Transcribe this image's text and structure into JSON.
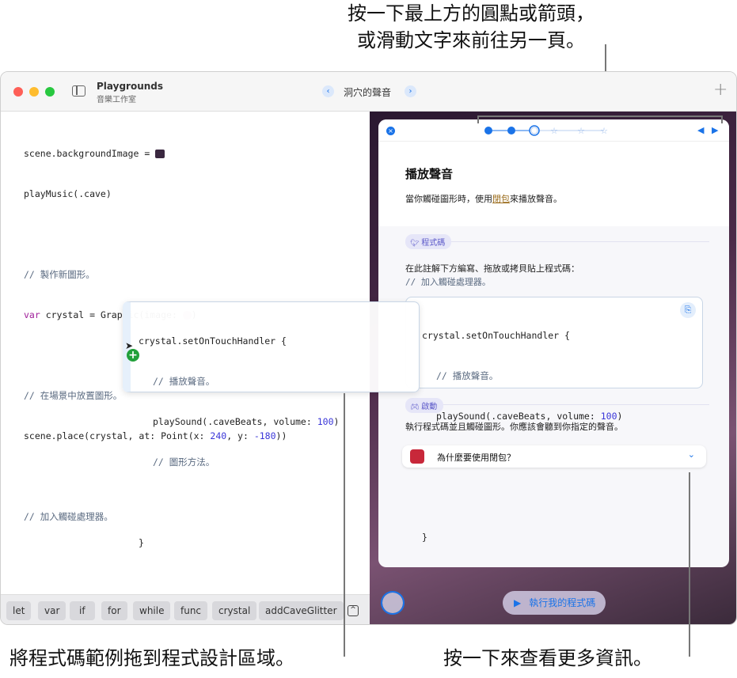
{
  "callouts": {
    "top_line1": "按一下最上方的圓點或箭頭，",
    "top_line2": "或滑動文字來前往另一頁。",
    "bottom_left": "將程式碼範例拖到程式設計區域。",
    "bottom_right": "按一下來查看更多資訊。"
  },
  "window": {
    "app_title": "Playgrounds",
    "subtitle": "音樂工作室",
    "page_title": "洞穴的聲音",
    "add_label": "+"
  },
  "editor": {
    "lines": [
      "scene.backgroundImage = ",
      "playMusic(.cave)",
      "// 製作新圖形。",
      "var",
      " crystal = Graphic(image: ",
      ")",
      "// 在場景中放置圖形。",
      "scene.place(crystal, at: Point(x: ",
      "240",
      ", y: ",
      "-180",
      "))",
      "// 加入觸碰處理器。"
    ]
  },
  "snippet": {
    "l1": "crystal.setOnTouchHandler {",
    "l2": "// 播放聲音。",
    "l3a": "playSound(.caveBeats, volume: ",
    "l3b": "100",
    "l3c": ")",
    "l4": "// 圖形方法。",
    "l5": "}"
  },
  "card": {
    "title": "播放聲音",
    "intro_a": "當你觸碰圖形時，使用",
    "intro_link": "閉包",
    "intro_b": "來播放聲音。",
    "code_tag": "程式碼",
    "instruction": "在此註解下方編寫、拖放或拷貝貼上程式碼：",
    "comment": "// 加入觸碰處理器。",
    "run_tag": "啟動",
    "run_text": "執行程式碼並且觸碰圖形。你應該會聽到你指定的聲音。",
    "disclosure": "為什麼要使用閉包？",
    "progress": {
      "completed": 2,
      "current": 3,
      "total": 6
    }
  },
  "run_button": "執行我的程式碼",
  "shortcuts": [
    "let",
    "var",
    "if",
    "for",
    "while",
    "func",
    "crystal",
    "addCaveGlitter"
  ],
  "colors": {
    "accent": "#1a73e8",
    "link": "#9a6b1a",
    "number": "#3a36d8",
    "keyword": "#a0209a"
  }
}
